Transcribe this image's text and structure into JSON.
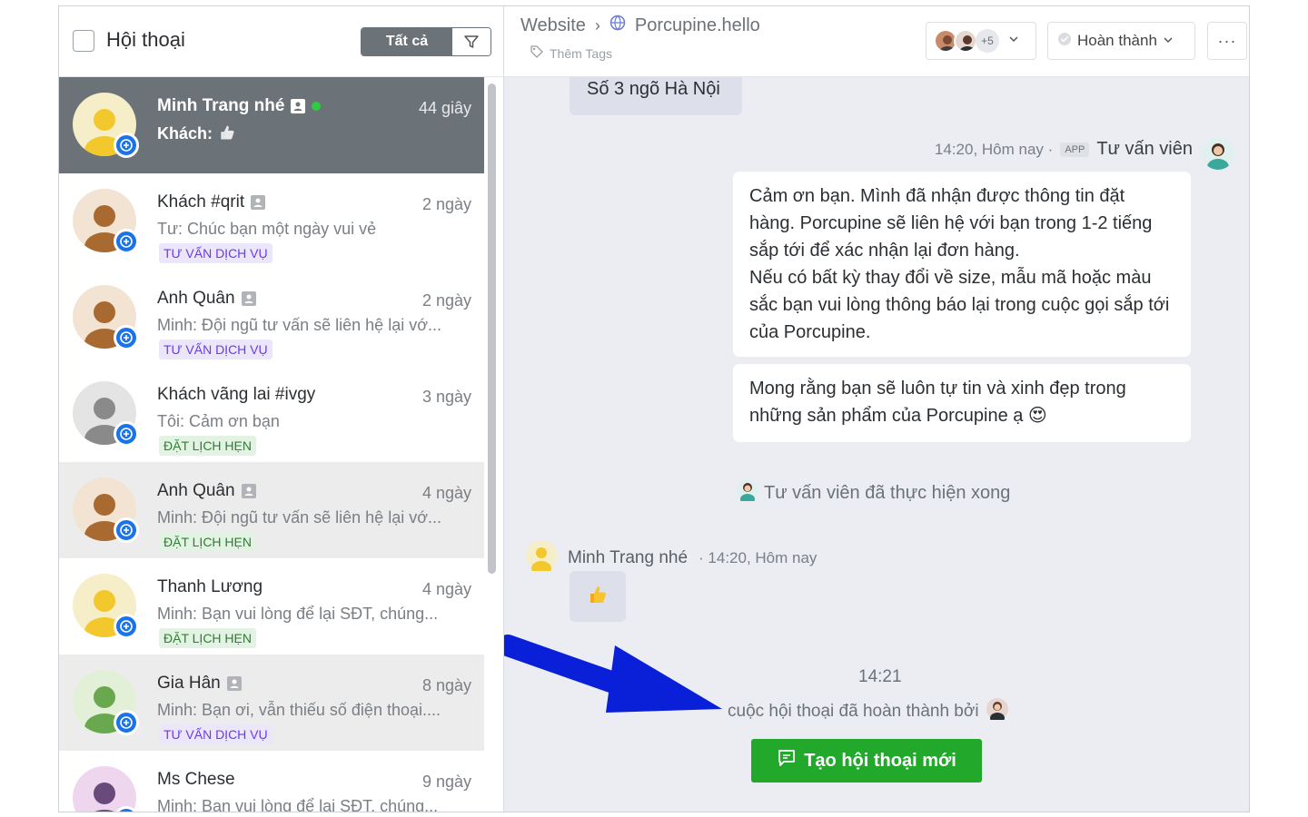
{
  "left_panel": {
    "title": "Hội thoại",
    "filter_all_label": "Tất cả"
  },
  "conversations": [
    {
      "name": "Minh Trang nhé",
      "time": "44 giây",
      "preview": "Khách:",
      "tag": "",
      "online": true,
      "avatar_color": "#f2c82c"
    },
    {
      "name": "Khách #qrit",
      "time": "2 ngày",
      "preview": "Tư: Chúc bạn một ngày vui vẻ",
      "tag": "TƯ VẤN DỊCH VỤ",
      "avatar_color": "#a86a30"
    },
    {
      "name": "Anh Quân",
      "time": "2 ngày",
      "preview": "Minh: Đội ngũ tư vấn sẽ liên hệ lại vớ...",
      "tag": "TƯ VẤN DỊCH VỤ",
      "avatar_color": "#a86a30"
    },
    {
      "name": "Khách vãng lai #ivgy",
      "time": "3 ngày",
      "preview": "Tôi: Cảm ơn bạn",
      "tag": "ĐẶT LỊCH HẸN",
      "avatar_color": "#8a8a8a"
    },
    {
      "name": "Anh Quân",
      "time": "4 ngày",
      "preview": "Minh: Đội ngũ tư vấn sẽ liên hệ lại vớ...",
      "tag": "ĐẶT LỊCH HẸN",
      "avatar_color": "#a86a30"
    },
    {
      "name": "Thanh Lương",
      "time": "4 ngày",
      "preview": "Minh: Bạn vui lòng để lại SĐT, chúng...",
      "tag": "ĐẶT LỊCH HẸN",
      "avatar_color": "#f2c82c"
    },
    {
      "name": "Gia Hân",
      "time": "8 ngày",
      "preview": "Minh: Bạn ơi, vẫn thiếu số điện thoại....",
      "tag": "TƯ VẤN DỊCH VỤ",
      "avatar_color": "#6aa84f"
    },
    {
      "name": "Ms Chese",
      "time": "9 ngày",
      "preview": "Minh: Bạn vui lòng để lại SĐT, chúng...",
      "tag": "",
      "avatar_color": "#6a4a7a"
    }
  ],
  "header": {
    "channel": "Website",
    "page_name": "Porcupine.hello",
    "add_tags": "Thêm Tags",
    "assignee_extra": "+5",
    "status_label": "Hoàn thành",
    "more_label": "···"
  },
  "chat": {
    "address_message": "Số 3 ngõ Hà Nội",
    "agent_time": "14:20, Hôm nay ·",
    "agent_app_badge": "APP",
    "agent_role": "Tư vấn viên",
    "message1": "Cảm ơn bạn. Mình đã nhận được thông tin đặt hàng. Porcupine sẽ liên hệ với bạn trong 1-2 tiếng sắp tới để xác nhận lại đơn hàng.\nNếu có bất kỳ thay đổi về size, mẫu mã hoặc màu sắc bạn vui lòng thông báo lại trong cuộc gọi sắp tới của Porcupine.",
    "message2": "Mong rằng bạn sẽ luôn tự tin và xinh đẹp trong những sản phẩm của Porcupine ạ 😍",
    "system_done": "Tư vấn viên đã thực hiện xong",
    "customer_name": "Minh Trang nhé",
    "customer_time": "· 14:20, Hôm nay",
    "close_time": "14:21",
    "close_text": "cuộc hội thoại đã hoàn thành bởi",
    "new_conversation_button": "Tạo hội thoại mới"
  },
  "colors": {
    "primary_green": "#22a82b",
    "active_row": "#6b7278",
    "tag_purple": "#6a3de0",
    "tag_green": "#2f7d32",
    "annotation_arrow": "#0a1fd8"
  }
}
